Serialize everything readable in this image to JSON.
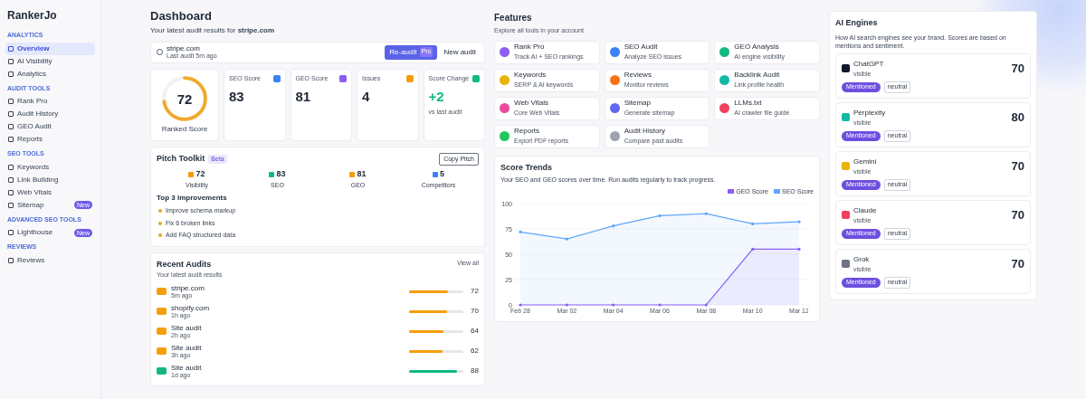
{
  "sidebar": {
    "brand": "RankerJo",
    "sections": [
      {
        "title": "ANALYTICS",
        "items": [
          {
            "label": "Overview",
            "selected": true
          },
          {
            "label": "AI Visibility",
            "selected": false
          },
          {
            "label": "Analytics",
            "selected": false
          }
        ]
      },
      {
        "title": "AUDIT TOOLS",
        "items": [
          {
            "label": "Rank Pro",
            "selected": false
          },
          {
            "label": "Audit History",
            "selected": false
          },
          {
            "label": "GEO Audit",
            "selected": false
          },
          {
            "label": "Reports",
            "selected": false
          }
        ]
      },
      {
        "title": "SEO TOOLS",
        "items": [
          {
            "label": "Keywords",
            "selected": false
          },
          {
            "label": "Link Building",
            "selected": false
          },
          {
            "label": "Web Vitals",
            "selected": false
          },
          {
            "label": "Sitemap",
            "selected": false,
            "badge": "New"
          }
        ]
      },
      {
        "title": "ADVANCED SEO TOOLS",
        "items": [
          {
            "label": "Lighthouse",
            "selected": false,
            "badge": "New"
          }
        ]
      },
      {
        "title": "REVIEWS",
        "items": [
          {
            "label": "Reviews",
            "selected": false
          }
        ]
      }
    ]
  },
  "header": {
    "title": "Dashboard",
    "subtitle": "Your latest audit results for **stripe.com**"
  },
  "site": {
    "domain": "stripe.com",
    "meta": "Last audit 5m ago",
    "reaudit": "Re-audit",
    "reaudit_badge": "Pro",
    "new_audit": "New audit"
  },
  "score": {
    "value": "72",
    "label": "Ranked Score"
  },
  "stats": [
    {
      "label": "SEO Score",
      "value": "83",
      "color": "#3b82f6"
    },
    {
      "label": "GEO Score",
      "value": "81",
      "color": "#8b5cf6"
    },
    {
      "label": "Issues",
      "value": "4",
      "color": "#f59e0b"
    },
    {
      "label": "Score Change",
      "value": "+2",
      "note": "vs last audit",
      "color": "#10b981"
    }
  ],
  "pitch": {
    "title": "Pitch Toolkit",
    "badge": "Beta",
    "copy": "Copy Pitch",
    "metrics": [
      {
        "value": "72",
        "label": "Visibility",
        "color": "#f59e0b"
      },
      {
        "value": "83",
        "label": "SEO",
        "color": "#10b981"
      },
      {
        "value": "81",
        "label": "GEO",
        "color": "#f59e0b"
      },
      {
        "value": "5",
        "label": "Competitors",
        "color": "#3b82f6"
      }
    ],
    "improvements_title": "Top 3 Improvements",
    "improvements": [
      "Improve schema markup",
      "Fix 6 broken links",
      "Add FAQ structured data"
    ]
  },
  "features": {
    "title": "Features",
    "subtitle": "Explore all tools in your account",
    "items": [
      {
        "name": "Rank Pro",
        "desc": "Track AI + SEO rankings",
        "color": "#8b5cf6"
      },
      {
        "name": "SEO Audit",
        "desc": "Analyze SEO issues",
        "color": "#3b82f6"
      },
      {
        "name": "GEO Analysis",
        "desc": "AI engine visibility",
        "color": "#10b981"
      },
      {
        "name": "Keywords",
        "desc": "SERP & AI keywords",
        "color": "#eab308"
      },
      {
        "name": "Reviews",
        "desc": "Monitor reviews",
        "color": "#f97316"
      },
      {
        "name": "Backlink Audit",
        "desc": "Link profile health",
        "color": "#14b8a6"
      },
      {
        "name": "Web Vitals",
        "desc": "Core Web Vitals",
        "color": "#ec4899"
      },
      {
        "name": "Sitemap",
        "desc": "Generate sitemap",
        "color": "#6366f1"
      },
      {
        "name": "LLMs.txt",
        "desc": "AI crawler file guide",
        "color": "#f43f5e"
      },
      {
        "name": "Reports",
        "desc": "Export PDF reports",
        "color": "#22c55e"
      },
      {
        "name": "Audit History",
        "desc": "Compare past audits",
        "color": "#9ca3af"
      }
    ]
  },
  "recent": {
    "title": "Recent Audits",
    "subtitle": "Your latest audit results",
    "view_all": "View all",
    "rows": [
      {
        "name": "stripe.com",
        "meta": "5m ago",
        "score": "72",
        "level": 0.72,
        "color": "#f59e0b"
      },
      {
        "name": "shopify.com",
        "meta": "1h ago",
        "score": "70",
        "level": 0.7,
        "color": "#f59e0b"
      },
      {
        "name": "Site audit",
        "meta": "2h ago",
        "score": "64",
        "level": 0.64,
        "color": "#f59e0b"
      },
      {
        "name": "Site audit",
        "meta": "3h ago",
        "score": "62",
        "level": 0.62,
        "color": "#f59e0b"
      },
      {
        "name": "Site audit",
        "meta": "1d ago",
        "score": "88",
        "level": 0.88,
        "color": "#10b981"
      }
    ]
  },
  "trends": {
    "title": "Score Trends",
    "subtitle": "Your SEO and GEO scores over time. Run audits regularly to track progress.",
    "chart_data": {
      "type": "line",
      "categories": [
        "Feb 28",
        "Mar 02",
        "Mar 04",
        "Mar 06",
        "Mar 08",
        "Mar 10",
        "Mar 12"
      ],
      "yticks": [
        0,
        25,
        50,
        75,
        100
      ],
      "ylim": [
        0,
        100
      ],
      "series": [
        {
          "name": "GEO Score",
          "color": "#8b5cf6",
          "values": [
            0,
            0,
            0,
            0,
            0,
            55,
            55
          ]
        },
        {
          "name": "SEO Score",
          "color": "#60a5fa",
          "values": [
            72,
            65,
            78,
            88,
            90,
            80,
            82
          ]
        }
      ]
    }
  },
  "engines": {
    "title": "AI Engines",
    "subtitle": "How AI search engines see your brand. Scores are based on mentions and sentiment.",
    "items": [
      {
        "name": "ChatGPT",
        "status": "visible",
        "score": "70",
        "tag": "Mentioned",
        "sentiment": "neutral",
        "color": "#111827"
      },
      {
        "name": "Perplexity",
        "status": "visible",
        "score": "80",
        "tag": "Mentioned",
        "sentiment": "neutral",
        "color": "#14b8a6"
      },
      {
        "name": "Gemini",
        "status": "visible",
        "score": "70",
        "tag": "Mentioned",
        "sentiment": "neutral",
        "color": "#eab308"
      },
      {
        "name": "Claude",
        "status": "visible",
        "score": "70",
        "tag": "Mentioned",
        "sentiment": "neutral",
        "color": "#f43f5e"
      },
      {
        "name": "Grok",
        "status": "visible",
        "score": "70",
        "tag": "Mentioned",
        "sentiment": "neutral",
        "color": "#6b7280"
      }
    ]
  }
}
